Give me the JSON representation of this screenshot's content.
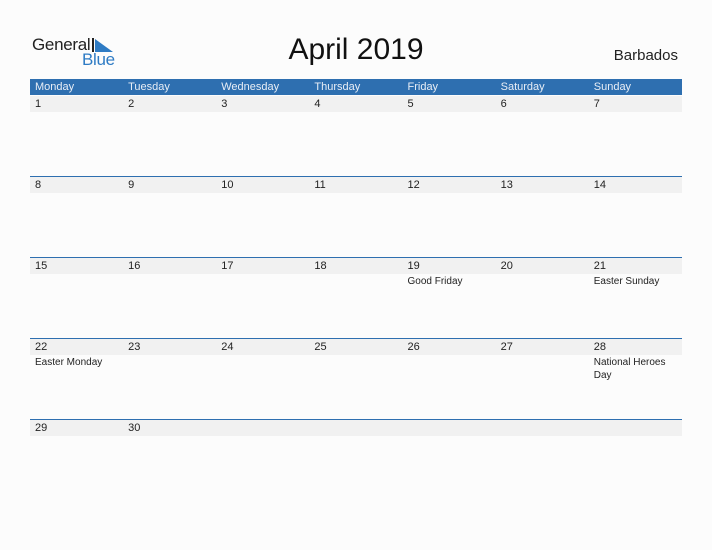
{
  "logo": {
    "word1": "General",
    "word2": "Blue"
  },
  "title": "April 2019",
  "country": "Barbados",
  "colors": {
    "accent": "#2e6fb0",
    "band": "#f1f1f1"
  },
  "weekdays": [
    "Monday",
    "Tuesday",
    "Wednesday",
    "Thursday",
    "Friday",
    "Saturday",
    "Sunday"
  ],
  "weeks": [
    {
      "days": [
        "1",
        "2",
        "3",
        "4",
        "5",
        "6",
        "7"
      ],
      "events": [
        "",
        "",
        "",
        "",
        "",
        "",
        ""
      ]
    },
    {
      "days": [
        "8",
        "9",
        "10",
        "11",
        "12",
        "13",
        "14"
      ],
      "events": [
        "",
        "",
        "",
        "",
        "",
        "",
        ""
      ]
    },
    {
      "days": [
        "15",
        "16",
        "17",
        "18",
        "19",
        "20",
        "21"
      ],
      "events": [
        "",
        "",
        "",
        "",
        "Good Friday",
        "",
        "Easter Sunday"
      ]
    },
    {
      "days": [
        "22",
        "23",
        "24",
        "25",
        "26",
        "27",
        "28"
      ],
      "events": [
        "Easter Monday",
        "",
        "",
        "",
        "",
        "",
        "National Heroes Day"
      ]
    },
    {
      "days": [
        "29",
        "30",
        "",
        "",
        "",
        "",
        ""
      ],
      "events": [
        "",
        "",
        "",
        "",
        "",
        "",
        ""
      ]
    }
  ]
}
